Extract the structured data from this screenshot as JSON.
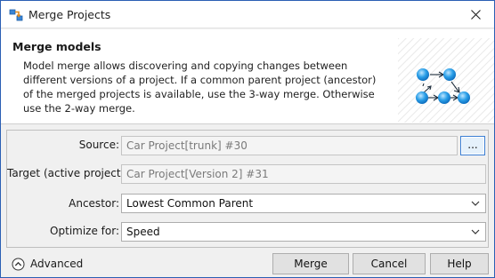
{
  "window": {
    "title": "Merge Projects",
    "app_icon": "merge-app-icon",
    "close_icon": "close-icon"
  },
  "header": {
    "title": "Merge models",
    "description": "Model merge allows discovering and copying changes between different versions of a project. If a common parent project (ancestor) of the merged projects is available, use the 3-way merge. Otherwise use the 2-way merge.",
    "graphic": "merge-graph-illustration"
  },
  "form": {
    "source": {
      "label": "Source:",
      "value": "Car Project[trunk] #30",
      "browse_label": "..."
    },
    "target": {
      "label": "Target (active project):",
      "value": "Car Project[Version 2] #31"
    },
    "ancestor": {
      "label": "Ancestor:",
      "selected": "Lowest Common Parent"
    },
    "optimize": {
      "label": "Optimize for:",
      "selected": "Speed"
    }
  },
  "footer": {
    "advanced_label": "Advanced",
    "advanced_icon": "chevron-up-circle-icon",
    "merge_label": "Merge",
    "cancel_label": "Cancel",
    "help_label": "Help"
  },
  "colors": {
    "accent_border": "#2b5fb4",
    "focus_blue": "#3b7fd4",
    "node_blue": "#2a9fe8"
  }
}
